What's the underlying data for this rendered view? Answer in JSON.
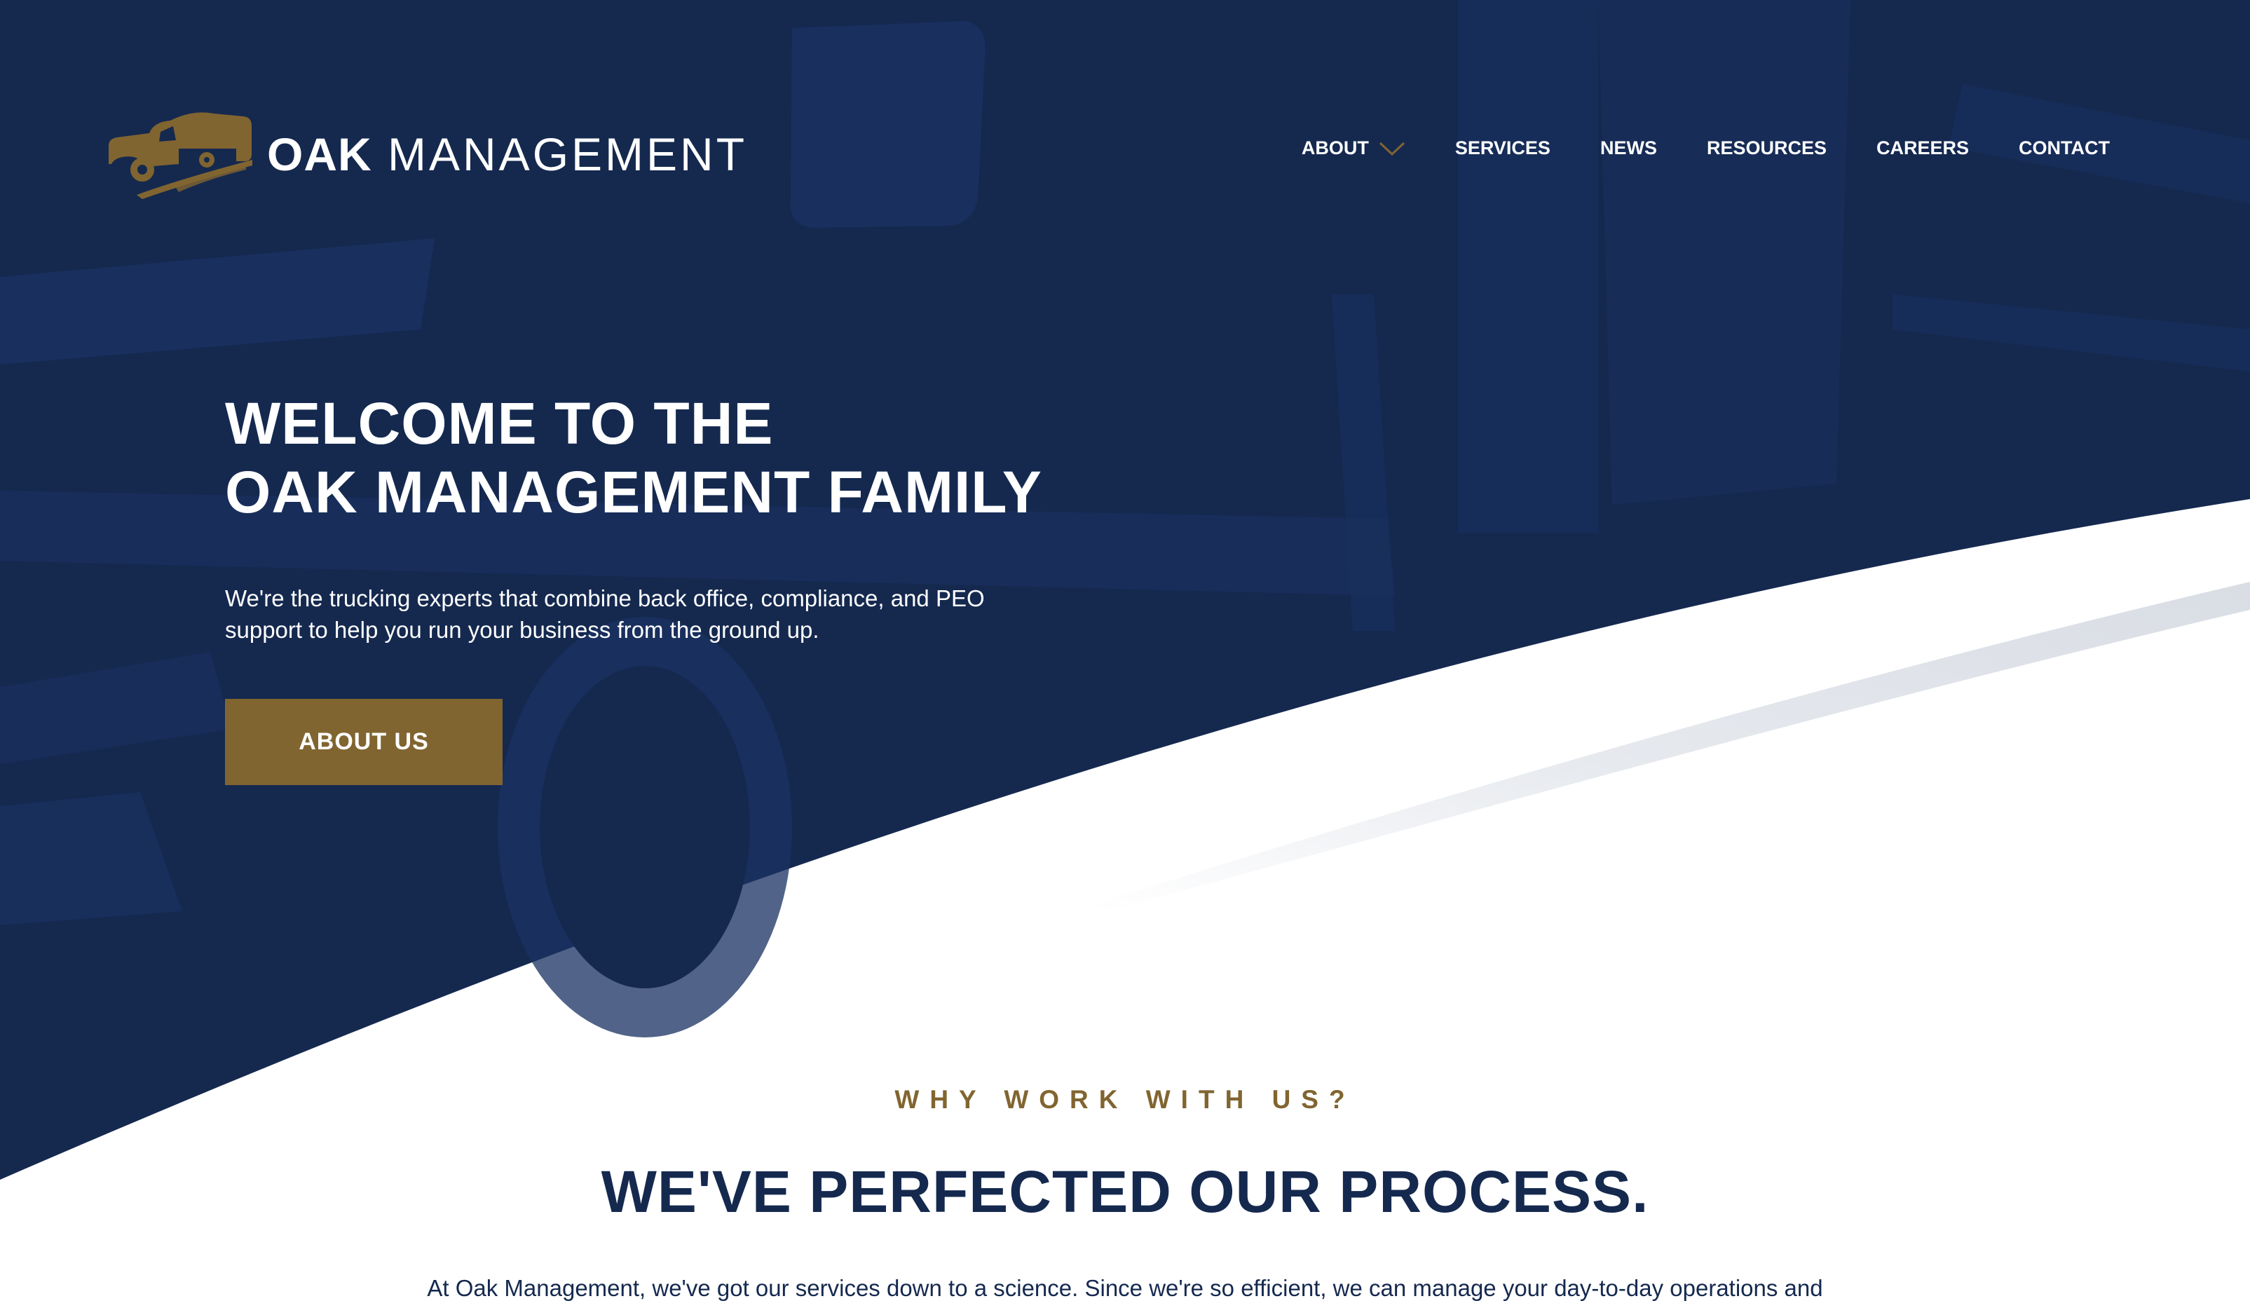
{
  "brand": {
    "name_strong": "OAK",
    "name_light": "MANAGEMENT",
    "logo_icon": "truck-icon"
  },
  "nav": {
    "items": [
      {
        "label": "ABOUT",
        "has_dropdown": true
      },
      {
        "label": "SERVICES"
      },
      {
        "label": "NEWS"
      },
      {
        "label": "RESOURCES"
      },
      {
        "label": "CAREERS"
      },
      {
        "label": "CONTACT"
      }
    ]
  },
  "hero": {
    "title_line1": "WELCOME TO THE",
    "title_line2": "OAK MANAGEMENT FAMILY",
    "description": "We're the trucking experts that combine back office, compliance, and PEO support to help you run your business from the ground up.",
    "button_label": "ABOUT US"
  },
  "why": {
    "eyebrow": "WHY WORK WITH US?",
    "title": "WE'VE PERFECTED OUR PROCESS.",
    "text": "At Oak Management, we've got our services down to a science. Since we're so efficient, we can manage your day-to-day operations and"
  },
  "colors": {
    "navy": "#15294f",
    "gold": "#816530",
    "white": "#ffffff",
    "swoosh_gray": "#dfe2e8"
  }
}
